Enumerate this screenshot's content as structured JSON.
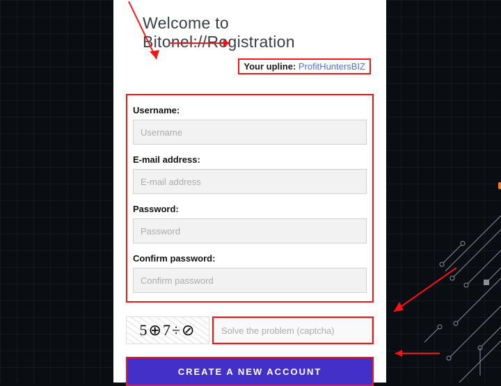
{
  "title": "Welcome to Bitonel://Registration",
  "upline": {
    "label": "Your upline:",
    "value": "ProfitHuntersBIZ"
  },
  "fields": {
    "username": {
      "label": "Username:",
      "placeholder": "Username"
    },
    "email": {
      "label": "E-mail address:",
      "placeholder": "E-mail address"
    },
    "password": {
      "label": "Password:",
      "placeholder": "Password"
    },
    "confirm": {
      "label": "Confirm password:",
      "placeholder": "Confirm password"
    }
  },
  "captcha": {
    "image_text": "5⊕7÷⊘",
    "placeholder": "Solve the problem (captcha)"
  },
  "submit": {
    "label": "CREATE A NEW ACCOUNT"
  }
}
